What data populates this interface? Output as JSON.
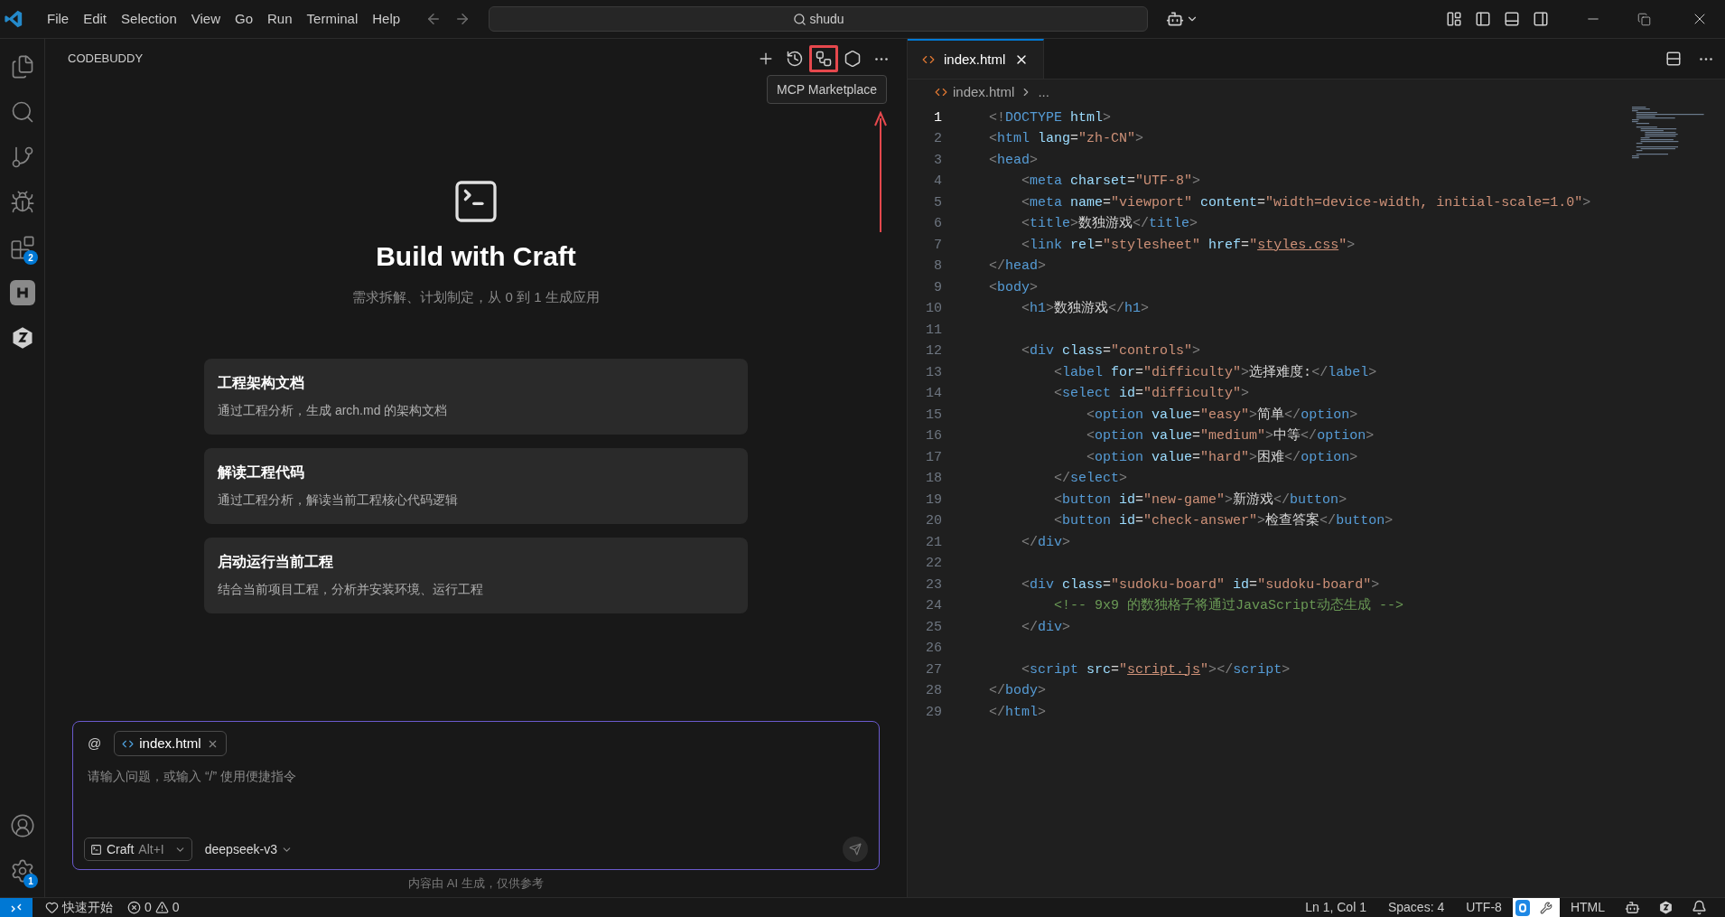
{
  "menu": [
    "File",
    "Edit",
    "Selection",
    "View",
    "Go",
    "Run",
    "Terminal",
    "Help"
  ],
  "search": {
    "value": "shudu"
  },
  "activity_bar": {
    "items": [
      {
        "kind": "files",
        "selected": false
      },
      {
        "kind": "search",
        "selected": false
      },
      {
        "kind": "source-control",
        "selected": false
      },
      {
        "kind": "run-debug",
        "selected": false
      },
      {
        "kind": "extensions",
        "selected": false,
        "badge": "2"
      },
      {
        "kind": "h-app",
        "selected": false
      },
      {
        "kind": "codebuddy",
        "selected": false
      }
    ],
    "bottom": [
      {
        "kind": "account"
      },
      {
        "kind": "settings",
        "badge": "1"
      }
    ]
  },
  "panel": {
    "title": "CODEBUDDY",
    "actions": [
      {
        "kind": "plus",
        "highlighted": false
      },
      {
        "kind": "history",
        "highlighted": false
      },
      {
        "kind": "mcp",
        "highlighted": true
      },
      {
        "kind": "settings",
        "highlighted": false
      },
      {
        "kind": "more",
        "highlighted": false
      }
    ],
    "tooltip": "MCP Marketplace",
    "heading": "Build with Craft",
    "subheading": "需求拆解、计划制定，从 0 到 1 生成应用",
    "cards": [
      {
        "title": "工程架构文档",
        "description": "通过工程分析，生成 arch.md 的架构文档"
      },
      {
        "title": "解读工程代码",
        "description": "通过工程分析，解读当前工程核心代码逻辑"
      },
      {
        "title": "启动运行当前工程",
        "description": "结合当前项目工程，分析并安装环境、运行工程"
      }
    ],
    "input": {
      "at": "@",
      "chip": "index.html",
      "placeholder": "请输入问题，或输入 “/” 使用便捷指令",
      "mode": "Craft",
      "shortcut": "Alt+I",
      "model": "deepseek-v3"
    },
    "disclaimer": "内容由 AI 生成，仅供参考"
  },
  "editor": {
    "tabs": [
      {
        "label": "index.html",
        "selected": true
      }
    ],
    "breadcrumb": [
      "index.html",
      "..."
    ],
    "lines": [
      {
        "number": "1",
        "current": true,
        "tokens": [
          {
            "kind": "p",
            "text": "<!"
          },
          {
            "kind": "tag",
            "text": "DOCTYPE"
          },
          {
            "kind": "attr",
            "text": " html"
          },
          {
            "kind": "p",
            "text": ">"
          }
        ]
      },
      {
        "number": "2",
        "current": false,
        "tokens": [
          {
            "kind": "p",
            "text": "<"
          },
          {
            "kind": "tag",
            "text": "html"
          },
          {
            "kind": "attr",
            "text": " lang"
          },
          {
            "kind": "text",
            "text": "="
          },
          {
            "kind": "str",
            "text": "\"zh-CN\""
          },
          {
            "kind": "p",
            "text": ">"
          }
        ]
      },
      {
        "number": "3",
        "current": false,
        "tokens": [
          {
            "kind": "p",
            "text": "<"
          },
          {
            "kind": "tag",
            "text": "head"
          },
          {
            "kind": "p",
            "text": ">"
          }
        ]
      },
      {
        "number": "4",
        "current": false,
        "tokens": [
          {
            "kind": "p",
            "text": "    <"
          },
          {
            "kind": "tag",
            "text": "meta"
          },
          {
            "kind": "attr",
            "text": " charset"
          },
          {
            "kind": "text",
            "text": "="
          },
          {
            "kind": "str",
            "text": "\"UTF-8\""
          },
          {
            "kind": "p",
            "text": ">"
          }
        ]
      },
      {
        "number": "5",
        "current": false,
        "tokens": [
          {
            "kind": "p",
            "text": "    <"
          },
          {
            "kind": "tag",
            "text": "meta"
          },
          {
            "kind": "attr",
            "text": " name"
          },
          {
            "kind": "text",
            "text": "="
          },
          {
            "kind": "str",
            "text": "\"viewport\""
          },
          {
            "kind": "attr",
            "text": " content"
          },
          {
            "kind": "text",
            "text": "="
          },
          {
            "kind": "str",
            "text": "\"width=device-width, initial-scale=1.0\""
          },
          {
            "kind": "p",
            "text": ">"
          }
        ]
      },
      {
        "number": "6",
        "current": false,
        "tokens": [
          {
            "kind": "p",
            "text": "    <"
          },
          {
            "kind": "tag",
            "text": "title"
          },
          {
            "kind": "p",
            "text": ">"
          },
          {
            "kind": "text",
            "text": "数独游戏"
          },
          {
            "kind": "p",
            "text": "</"
          },
          {
            "kind": "tag",
            "text": "title"
          },
          {
            "kind": "p",
            "text": ">"
          }
        ]
      },
      {
        "number": "7",
        "current": false,
        "tokens": [
          {
            "kind": "p",
            "text": "    <"
          },
          {
            "kind": "tag",
            "text": "link"
          },
          {
            "kind": "attr",
            "text": " rel"
          },
          {
            "kind": "text",
            "text": "="
          },
          {
            "kind": "str",
            "text": "\"stylesheet\""
          },
          {
            "kind": "attr",
            "text": " href"
          },
          {
            "kind": "text",
            "text": "="
          },
          {
            "kind": "str",
            "text": "\""
          },
          {
            "kind": "link",
            "text": "styles.css"
          },
          {
            "kind": "str",
            "text": "\""
          },
          {
            "kind": "p",
            "text": ">"
          }
        ]
      },
      {
        "number": "8",
        "current": false,
        "tokens": [
          {
            "kind": "p",
            "text": "</"
          },
          {
            "kind": "tag",
            "text": "head"
          },
          {
            "kind": "p",
            "text": ">"
          }
        ]
      },
      {
        "number": "9",
        "current": false,
        "tokens": [
          {
            "kind": "p",
            "text": "<"
          },
          {
            "kind": "tag",
            "text": "body"
          },
          {
            "kind": "p",
            "text": ">"
          }
        ]
      },
      {
        "number": "10",
        "current": false,
        "tokens": [
          {
            "kind": "p",
            "text": "    <"
          },
          {
            "kind": "tag",
            "text": "h1"
          },
          {
            "kind": "p",
            "text": ">"
          },
          {
            "kind": "text",
            "text": "数独游戏"
          },
          {
            "kind": "p",
            "text": "</"
          },
          {
            "kind": "tag",
            "text": "h1"
          },
          {
            "kind": "p",
            "text": ">"
          }
        ]
      },
      {
        "number": "11",
        "current": false
      },
      {
        "number": "12",
        "current": false,
        "tokens": [
          {
            "kind": "p",
            "text": "    <"
          },
          {
            "kind": "tag",
            "text": "div"
          },
          {
            "kind": "attr",
            "text": " class"
          },
          {
            "kind": "text",
            "text": "="
          },
          {
            "kind": "str",
            "text": "\"controls\""
          },
          {
            "kind": "p",
            "text": ">"
          }
        ]
      },
      {
        "number": "13",
        "current": false,
        "tokens": [
          {
            "kind": "p",
            "text": "        <"
          },
          {
            "kind": "tag",
            "text": "label"
          },
          {
            "kind": "attr",
            "text": " for"
          },
          {
            "kind": "text",
            "text": "="
          },
          {
            "kind": "str",
            "text": "\"difficulty\""
          },
          {
            "kind": "p",
            "text": ">"
          },
          {
            "kind": "text",
            "text": "选择难度:"
          },
          {
            "kind": "p",
            "text": "</"
          },
          {
            "kind": "tag",
            "text": "label"
          },
          {
            "kind": "p",
            "text": ">"
          }
        ]
      },
      {
        "number": "14",
        "current": false,
        "tokens": [
          {
            "kind": "p",
            "text": "        <"
          },
          {
            "kind": "tag",
            "text": "select"
          },
          {
            "kind": "attr",
            "text": " id"
          },
          {
            "kind": "text",
            "text": "="
          },
          {
            "kind": "str",
            "text": "\"difficulty\""
          },
          {
            "kind": "p",
            "text": ">"
          }
        ]
      },
      {
        "number": "15",
        "current": false,
        "tokens": [
          {
            "kind": "p",
            "text": "            <"
          },
          {
            "kind": "tag",
            "text": "option"
          },
          {
            "kind": "attr",
            "text": " value"
          },
          {
            "kind": "text",
            "text": "="
          },
          {
            "kind": "str",
            "text": "\"easy\""
          },
          {
            "kind": "p",
            "text": ">"
          },
          {
            "kind": "text",
            "text": "简单"
          },
          {
            "kind": "p",
            "text": "</"
          },
          {
            "kind": "tag",
            "text": "option"
          },
          {
            "kind": "p",
            "text": ">"
          }
        ]
      },
      {
        "number": "16",
        "current": false,
        "tokens": [
          {
            "kind": "p",
            "text": "            <"
          },
          {
            "kind": "tag",
            "text": "option"
          },
          {
            "kind": "attr",
            "text": " value"
          },
          {
            "kind": "text",
            "text": "="
          },
          {
            "kind": "str",
            "text": "\"medium\""
          },
          {
            "kind": "p",
            "text": ">"
          },
          {
            "kind": "text",
            "text": "中等"
          },
          {
            "kind": "p",
            "text": "</"
          },
          {
            "kind": "tag",
            "text": "option"
          },
          {
            "kind": "p",
            "text": ">"
          }
        ]
      },
      {
        "number": "17",
        "current": false,
        "tokens": [
          {
            "kind": "p",
            "text": "            <"
          },
          {
            "kind": "tag",
            "text": "option"
          },
          {
            "kind": "attr",
            "text": " value"
          },
          {
            "kind": "text",
            "text": "="
          },
          {
            "kind": "str",
            "text": "\"hard\""
          },
          {
            "kind": "p",
            "text": ">"
          },
          {
            "kind": "text",
            "text": "困难"
          },
          {
            "kind": "p",
            "text": "</"
          },
          {
            "kind": "tag",
            "text": "option"
          },
          {
            "kind": "p",
            "text": ">"
          }
        ]
      },
      {
        "number": "18",
        "current": false,
        "tokens": [
          {
            "kind": "p",
            "text": "        </"
          },
          {
            "kind": "tag",
            "text": "select"
          },
          {
            "kind": "p",
            "text": ">"
          }
        ]
      },
      {
        "number": "19",
        "current": false,
        "tokens": [
          {
            "kind": "p",
            "text": "        <"
          },
          {
            "kind": "tag",
            "text": "button"
          },
          {
            "kind": "attr",
            "text": " id"
          },
          {
            "kind": "text",
            "text": "="
          },
          {
            "kind": "str",
            "text": "\"new-game\""
          },
          {
            "kind": "p",
            "text": ">"
          },
          {
            "kind": "text",
            "text": "新游戏"
          },
          {
            "kind": "p",
            "text": "</"
          },
          {
            "kind": "tag",
            "text": "button"
          },
          {
            "kind": "p",
            "text": ">"
          }
        ]
      },
      {
        "number": "20",
        "current": false,
        "tokens": [
          {
            "kind": "p",
            "text": "        <"
          },
          {
            "kind": "tag",
            "text": "button"
          },
          {
            "kind": "attr",
            "text": " id"
          },
          {
            "kind": "text",
            "text": "="
          },
          {
            "kind": "str",
            "text": "\"check-answer\""
          },
          {
            "kind": "p",
            "text": ">"
          },
          {
            "kind": "text",
            "text": "检查答案"
          },
          {
            "kind": "p",
            "text": "</"
          },
          {
            "kind": "tag",
            "text": "button"
          },
          {
            "kind": "p",
            "text": ">"
          }
        ]
      },
      {
        "number": "21",
        "current": false,
        "tokens": [
          {
            "kind": "p",
            "text": "    </"
          },
          {
            "kind": "tag",
            "text": "div"
          },
          {
            "kind": "p",
            "text": ">"
          }
        ]
      },
      {
        "number": "22",
        "current": false
      },
      {
        "number": "23",
        "current": false,
        "tokens": [
          {
            "kind": "p",
            "text": "    <"
          },
          {
            "kind": "tag",
            "text": "div"
          },
          {
            "kind": "attr",
            "text": " class"
          },
          {
            "kind": "text",
            "text": "="
          },
          {
            "kind": "str",
            "text": "\"sudoku-board\""
          },
          {
            "kind": "attr",
            "text": " id"
          },
          {
            "kind": "text",
            "text": "="
          },
          {
            "kind": "str",
            "text": "\"sudoku-board\""
          },
          {
            "kind": "p",
            "text": ">"
          }
        ]
      },
      {
        "number": "24",
        "current": false,
        "tokens": [
          {
            "kind": "com",
            "text": "        <!-- 9x9 的数独格子将通过JavaScript动态生成 -->"
          }
        ]
      },
      {
        "number": "25",
        "current": false,
        "tokens": [
          {
            "kind": "p",
            "text": "    </"
          },
          {
            "kind": "tag",
            "text": "div"
          },
          {
            "kind": "p",
            "text": ">"
          }
        ]
      },
      {
        "number": "26",
        "current": false
      },
      {
        "number": "27",
        "current": false,
        "tokens": [
          {
            "kind": "p",
            "text": "    <"
          },
          {
            "kind": "tag",
            "text": "script"
          },
          {
            "kind": "attr",
            "text": " src"
          },
          {
            "kind": "text",
            "text": "="
          },
          {
            "kind": "str",
            "text": "\""
          },
          {
            "kind": "link",
            "text": "script.js"
          },
          {
            "kind": "str",
            "text": "\""
          },
          {
            "kind": "p",
            "text": ">"
          },
          {
            "kind": "p",
            "text": "</"
          },
          {
            "kind": "tag",
            "text": "script"
          },
          {
            "kind": "p",
            "text": ">"
          }
        ]
      },
      {
        "number": "28",
        "current": false,
        "tokens": [
          {
            "kind": "p",
            "text": "</"
          },
          {
            "kind": "tag",
            "text": "body"
          },
          {
            "kind": "p",
            "text": ">"
          }
        ]
      },
      {
        "number": "29",
        "current": false,
        "tokens": [
          {
            "kind": "p",
            "text": "</"
          },
          {
            "kind": "tag",
            "text": "html"
          },
          {
            "kind": "p",
            "text": ">"
          }
        ]
      }
    ]
  },
  "status_bar": {
    "left": [
      {
        "kind": "heart",
        "text": "快速开始"
      },
      {
        "kind": "errors",
        "text": "0"
      },
      {
        "kind": "warnings",
        "text": "0"
      }
    ],
    "right": [
      {
        "kind": "text",
        "text": "Ln 1, Col 1"
      },
      {
        "kind": "text",
        "text": "Spaces: 4"
      },
      {
        "kind": "text",
        "text": "UTF-8"
      },
      {
        "kind": "q-app"
      },
      {
        "kind": "tool"
      },
      {
        "kind": "text",
        "text": "HTML"
      },
      {
        "kind": "copilot"
      },
      {
        "kind": "codebuddy"
      },
      {
        "kind": "bell"
      }
    ]
  }
}
